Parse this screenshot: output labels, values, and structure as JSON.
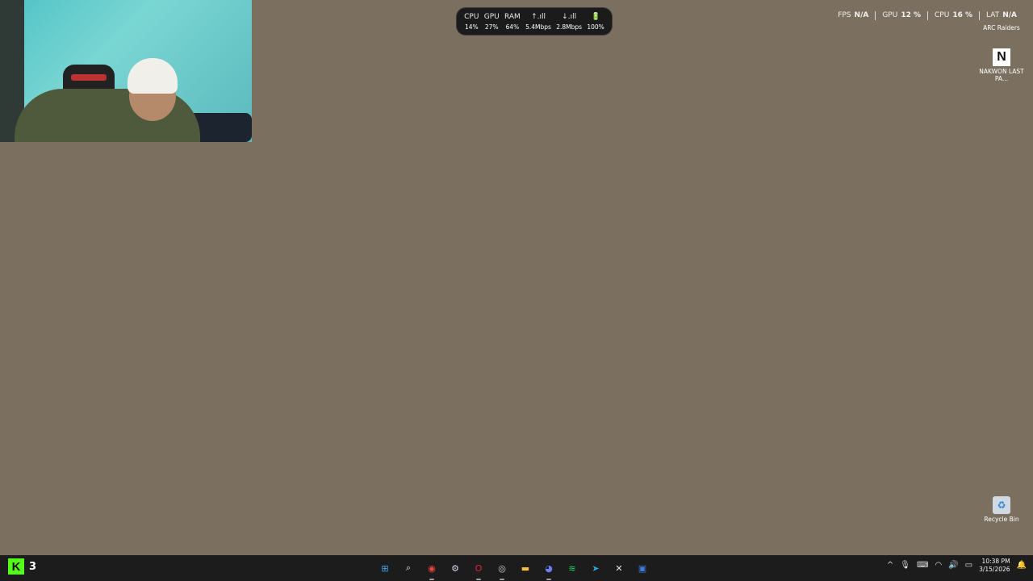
{
  "sysmon": {
    "items": [
      {
        "label": "CPU",
        "value": "14%"
      },
      {
        "label": "GPU",
        "value": "27%"
      },
      {
        "label": "RAM",
        "value": "64%"
      },
      {
        "label": "↑.ıll",
        "value": "5.4Mbps"
      },
      {
        "label": "↓.ıll",
        "value": "2.8Mbps"
      },
      {
        "label": "🔋",
        "value": "100%"
      }
    ]
  },
  "perf_overlay": {
    "fps_label": "FPS",
    "fps_value": "N/A",
    "gpu_label": "GPU",
    "gpu_value": "12 %",
    "cpu_label": "CPU",
    "cpu_value": "16 %",
    "lat_label": "LAT",
    "lat_value": "N/A"
  },
  "desktop_icons": {
    "arc": {
      "label": "ARC Raiders"
    },
    "nakwon": {
      "glyph": "N",
      "label": "NAKWON LAST PA..."
    },
    "recycle": {
      "glyph": "♻",
      "label": "Recycle Bin"
    }
  },
  "taskbar": {
    "kick_glyph": "K",
    "kick_count": "3",
    "apps": [
      {
        "name": "start-icon",
        "glyph": "⊞",
        "color": "#3fa7f5"
      },
      {
        "name": "search-icon",
        "glyph": "⌕",
        "color": "#e6e6e6"
      },
      {
        "name": "chrome-icon",
        "glyph": "◉",
        "color": "#e8463a"
      },
      {
        "name": "steam-icon",
        "glyph": "⚙",
        "color": "#cfd8e6"
      },
      {
        "name": "opera-gx-icon",
        "glyph": "O",
        "color": "#e8223f"
      },
      {
        "name": "obs-icon",
        "glyph": "◎",
        "color": "#d0d0d0"
      },
      {
        "name": "file-explorer-icon",
        "glyph": "▬",
        "color": "#f3c03a"
      },
      {
        "name": "discord-icon",
        "glyph": "◕",
        "color": "#6f7cf2"
      },
      {
        "name": "spotify-icon",
        "glyph": "≋",
        "color": "#1ed760"
      },
      {
        "name": "telegram-icon",
        "glyph": "➤",
        "color": "#2aa3dc"
      },
      {
        "name": "capcut-icon",
        "glyph": "✕",
        "color": "#e8e8e8"
      },
      {
        "name": "roblox-icon",
        "glyph": "▣",
        "color": "#3d7de0"
      }
    ],
    "tray": {
      "chevron": "^",
      "mic": "🎙",
      "keyboard": "⌨",
      "wifi": "◠",
      "volume": "🔊",
      "battery": "▭",
      "time": "10:38 PM",
      "date": "3/15/2026",
      "notify": "🔔"
    }
  },
  "colors": {
    "desktop": "#7b705f",
    "taskbar": "#1c1c1c",
    "kick_green": "#53fc18"
  }
}
